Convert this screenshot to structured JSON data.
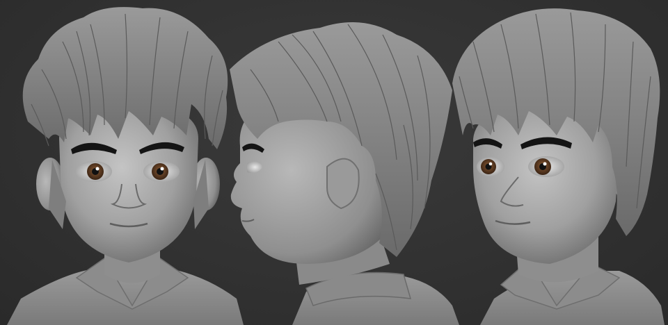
{
  "scene": {
    "background_color": "#333333",
    "clay_color": "#9c9c9c",
    "hair_color": "#8a8a8a",
    "brow_color": "#141414",
    "iris_color": "#5a3a22",
    "views": [
      "front",
      "side",
      "three-quarter"
    ]
  }
}
